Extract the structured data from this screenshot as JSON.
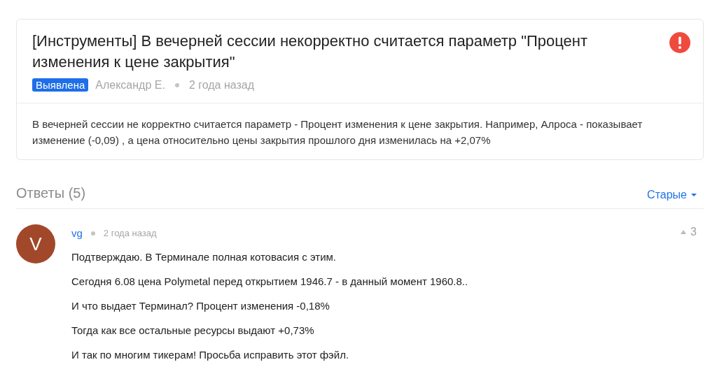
{
  "issue": {
    "title": "[Инструменты] В вечерней сессии некорректно считается параметр \"Процент изменения к цене закрытия\"",
    "status": {
      "label": "Выявлена",
      "kind": "found"
    },
    "author": "Александр Е.",
    "time": "2 года назад",
    "body": "В вечерней сессии не корректно считается параметр - Процент изменения к цене закрытия. Например, Алроса - показывает изменение (-0,09) , а цена относительно цены закрытия прошлого дня изменилась на +2,07%"
  },
  "answers": {
    "title": "Ответы (5)",
    "sort": "Старые",
    "comments": [
      {
        "avatar": "V",
        "author": "vg",
        "time": "2 года назад",
        "votes": "3",
        "paragraphs": [
          "Подтверждаю. В Терминале полная котовасия с этим.",
          "Сегодня 6.08 цена Polymetal перед открытием 1946.7 - в данный момент 1960.8..",
          "И что выдает Терминал? Процент изменения -0,18%",
          "Тогда как все остальные ресурсы выдают +0,73%",
          "И так по многим тикерам! Просьба исправить этот фэйл."
        ]
      }
    ]
  }
}
